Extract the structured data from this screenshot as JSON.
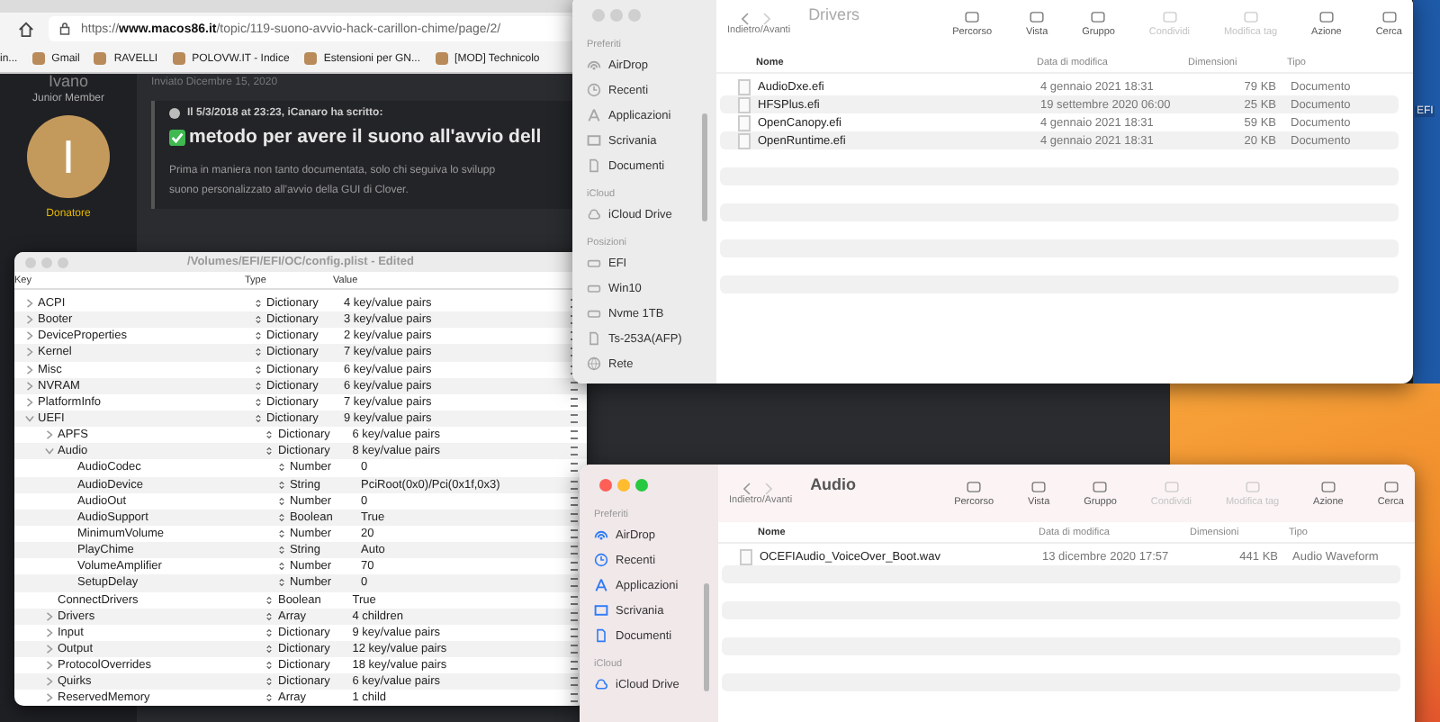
{
  "browser": {
    "url": "https://**www.macos86.it**/topic/119-suono-avvio-hack-carillon-chime/page/2/",
    "bookmarks": [
      {
        "label": "in..."
      },
      {
        "label": "Gmail"
      },
      {
        "label": "RAVELLI"
      },
      {
        "label": "POLOVW.IT - Indice"
      },
      {
        "label": "Estensioni per GN..."
      },
      {
        "label": "[MOD] Technicolo"
      }
    ],
    "forum": {
      "author": "Ivano",
      "rank": "Junior Member",
      "avatar_letter": "I",
      "badge": "Donatore",
      "posted": "Inviato Dicembre 15, 2020",
      "quote_header": "Il 5/3/2018 at 23:23, iCanaro ha scritto:",
      "heading": "metodo per avere il suono all'avvio dell",
      "paragraph_lines": [
        "Prima in maniera non tanto documentata, solo chi seguiva lo svilupp",
        "suono personalizzato all'avvio della GUI di Clover."
      ]
    }
  },
  "plist_editor": {
    "title": "/Volumes/EFI/EFI/OC/config.plist - Edited",
    "columns": [
      "Key",
      "Type",
      "Value"
    ],
    "rows": [
      {
        "key": "ACPI",
        "type": "Dictionary",
        "value": "4 key/value pairs",
        "expanded": false
      },
      {
        "key": "Booter",
        "type": "Dictionary",
        "value": "3 key/value pairs",
        "expanded": false
      },
      {
        "key": "DeviceProperties",
        "type": "Dictionary",
        "value": "2 key/value pairs",
        "expanded": false
      },
      {
        "key": "Kernel",
        "type": "Dictionary",
        "value": "7 key/value pairs",
        "expanded": false
      },
      {
        "key": "Misc",
        "type": "Dictionary",
        "value": "6 key/value pairs",
        "expanded": false
      },
      {
        "key": "NVRAM",
        "type": "Dictionary",
        "value": "6 key/value pairs",
        "expanded": false
      },
      {
        "key": "PlatformInfo",
        "type": "Dictionary",
        "value": "7 key/value pairs",
        "expanded": false
      },
      {
        "key": "UEFI",
        "type": "Dictionary",
        "value": "9 key/value pairs",
        "expanded": true,
        "children": [
          {
            "key": "APFS",
            "type": "Dictionary",
            "value": "6 key/value pairs",
            "expanded": false
          },
          {
            "key": "Audio",
            "type": "Dictionary",
            "value": "8 key/value pairs",
            "expanded": true,
            "children": [
              {
                "key": "AudioCodec",
                "type": "Number",
                "value": "0"
              },
              {
                "key": "AudioDevice",
                "type": "String",
                "value": "PciRoot(0x0)/Pci(0x1f,0x3)"
              },
              {
                "key": "AudioOut",
                "type": "Number",
                "value": "0"
              },
              {
                "key": "AudioSupport",
                "type": "Boolean",
                "value": "True"
              },
              {
                "key": "MinimumVolume",
                "type": "Number",
                "value": "20"
              },
              {
                "key": "PlayChime",
                "type": "String",
                "value": "Auto"
              },
              {
                "key": "VolumeAmplifier",
                "type": "Number",
                "value": "70"
              },
              {
                "key": "SetupDelay",
                "type": "Number",
                "value": "0"
              }
            ]
          },
          {
            "key": "ConnectDrivers",
            "type": "Boolean",
            "value": "True"
          },
          {
            "key": "Drivers",
            "type": "Array",
            "value": "4 children",
            "expanded": false
          },
          {
            "key": "Input",
            "type": "Dictionary",
            "value": "9 key/value pairs",
            "expanded": false
          },
          {
            "key": "Output",
            "type": "Dictionary",
            "value": "12 key/value pairs",
            "expanded": false
          },
          {
            "key": "ProtocolOverrides",
            "type": "Dictionary",
            "value": "18 key/value pairs",
            "expanded": false
          },
          {
            "key": "Quirks",
            "type": "Dictionary",
            "value": "6 key/value pairs",
            "expanded": false
          },
          {
            "key": "ReservedMemory",
            "type": "Array",
            "value": "1 child",
            "expanded": false
          }
        ]
      }
    ]
  },
  "finder_windows": [
    {
      "title": "Drivers",
      "active": false,
      "nav_label": "Indietro/Avanti",
      "toolbar": [
        {
          "label": "Percorso",
          "disabled": false
        },
        {
          "label": "Vista",
          "disabled": false
        },
        {
          "label": "Gruppo",
          "disabled": false
        },
        {
          "label": "Condividi",
          "disabled": true
        },
        {
          "label": "Modifica tag",
          "disabled": true
        },
        {
          "label": "Azione",
          "disabled": false
        },
        {
          "label": "Cerca",
          "disabled": false
        }
      ],
      "sidebar": [
        {
          "heading": "Preferiti",
          "items": [
            {
              "kind": "airdrop",
              "label": "AirDrop"
            },
            {
              "kind": "clock",
              "label": "Recenti"
            },
            {
              "kind": "apps",
              "label": "Applicazioni"
            },
            {
              "kind": "desktop",
              "label": "Scrivania"
            },
            {
              "kind": "doc",
              "label": "Documenti"
            }
          ]
        },
        {
          "heading": "iCloud",
          "items": [
            {
              "kind": "cloud",
              "label": "iCloud Drive"
            }
          ]
        },
        {
          "heading": "Posizioni",
          "items": [
            {
              "kind": "disk",
              "label": "EFI"
            },
            {
              "kind": "disk",
              "label": "Win10"
            },
            {
              "kind": "disk",
              "label": "Nvme 1TB"
            },
            {
              "kind": "doc",
              "label": "Ts-253A(AFP)"
            },
            {
              "kind": "globe",
              "label": "Rete"
            }
          ]
        }
      ],
      "columns": [
        "Nome",
        "Data di modifica",
        "Dimensioni",
        "Tipo"
      ],
      "files": [
        {
          "name": "AudioDxe.efi",
          "date": "4 gennaio 2021 18:31",
          "size": "79 KB",
          "type": "Documento"
        },
        {
          "name": "HFSPlus.efi",
          "date": "19 settembre 2020 06:00",
          "size": "25 KB",
          "type": "Documento"
        },
        {
          "name": "OpenCanopy.efi",
          "date": "4 gennaio 2021 18:31",
          "size": "59 KB",
          "type": "Documento"
        },
        {
          "name": "OpenRuntime.efi",
          "date": "4 gennaio 2021 18:31",
          "size": "20 KB",
          "type": "Documento"
        }
      ]
    },
    {
      "title": "Audio",
      "active": true,
      "nav_label": "Indietro/Avanti",
      "toolbar": [
        {
          "label": "Percorso",
          "disabled": false
        },
        {
          "label": "Vista",
          "disabled": false
        },
        {
          "label": "Gruppo",
          "disabled": false
        },
        {
          "label": "Condividi",
          "disabled": true
        },
        {
          "label": "Modifica tag",
          "disabled": true
        },
        {
          "label": "Azione",
          "disabled": false
        },
        {
          "label": "Cerca",
          "disabled": false
        }
      ],
      "sidebar": [
        {
          "heading": "Preferiti",
          "items": [
            {
              "kind": "airdrop",
              "label": "AirDrop"
            },
            {
              "kind": "clock",
              "label": "Recenti"
            },
            {
              "kind": "apps",
              "label": "Applicazioni"
            },
            {
              "kind": "desktop",
              "label": "Scrivania"
            },
            {
              "kind": "doc",
              "label": "Documenti"
            }
          ]
        },
        {
          "heading": "iCloud",
          "items": [
            {
              "kind": "cloud",
              "label": "iCloud Drive"
            }
          ]
        }
      ],
      "columns": [
        "Nome",
        "Data di modifica",
        "Dimensioni",
        "Tipo"
      ],
      "files": [
        {
          "name": "OCEFIAudio_VoiceOver_Boot.wav",
          "date": "13 dicembre 2020 17:57",
          "size": "441 KB",
          "type": "Audio Waveform"
        }
      ]
    }
  ],
  "desktop": {
    "icon_label": "EFI"
  }
}
